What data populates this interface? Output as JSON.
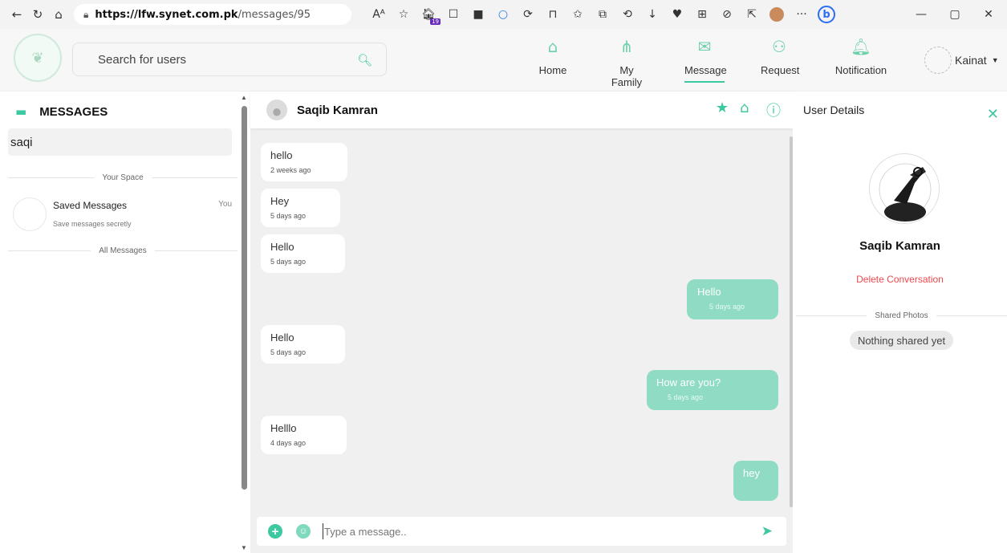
{
  "browser": {
    "url_host": "https://lfw.synet.com.pk",
    "url_path": "/messages/95",
    "badge_count": "19"
  },
  "search": {
    "placeholder": "Search for users"
  },
  "nav": {
    "home": "Home",
    "family": "My Family",
    "message": "Message",
    "request": "Request",
    "notification": "Notification"
  },
  "user": {
    "name": "Kainat"
  },
  "messages_panel": {
    "title": "MESSAGES",
    "search_value": "saqi",
    "your_space": "Your Space",
    "saved_title": "Saved Messages",
    "saved_sub": "Save messages secretly",
    "saved_you": "You",
    "all_messages": "All Messages"
  },
  "chat": {
    "contact_name": "Saqib Kamran",
    "messages": [
      {
        "text": "hello",
        "time": "2 weeks ago",
        "direction": "incoming"
      },
      {
        "text": "Hey",
        "time": "5 days ago",
        "direction": "incoming"
      },
      {
        "text": "Hello",
        "time": "5 days ago",
        "direction": "incoming"
      },
      {
        "text": "Hello",
        "time": "5 days ago",
        "direction": "outgoing"
      },
      {
        "text": "Hello",
        "time": "5 days ago",
        "direction": "incoming"
      },
      {
        "text": "How are you?",
        "time": "5 days ago",
        "direction": "outgoing"
      },
      {
        "text": "Helllo",
        "time": "4 days ago",
        "direction": "incoming"
      },
      {
        "text": "hey",
        "time": "",
        "direction": "outgoing"
      }
    ],
    "composer_placeholder": "Type a message.."
  },
  "details": {
    "title": "User Details",
    "name": "Saqib Kamran",
    "delete": "Delete Conversation",
    "shared_photos": "Shared Photos",
    "nothing_shared": "Nothing shared yet"
  },
  "colors": {
    "accent": "#3cc8a0",
    "outgoing_bubble": "#8fdbc3",
    "danger": "#f0484f"
  }
}
